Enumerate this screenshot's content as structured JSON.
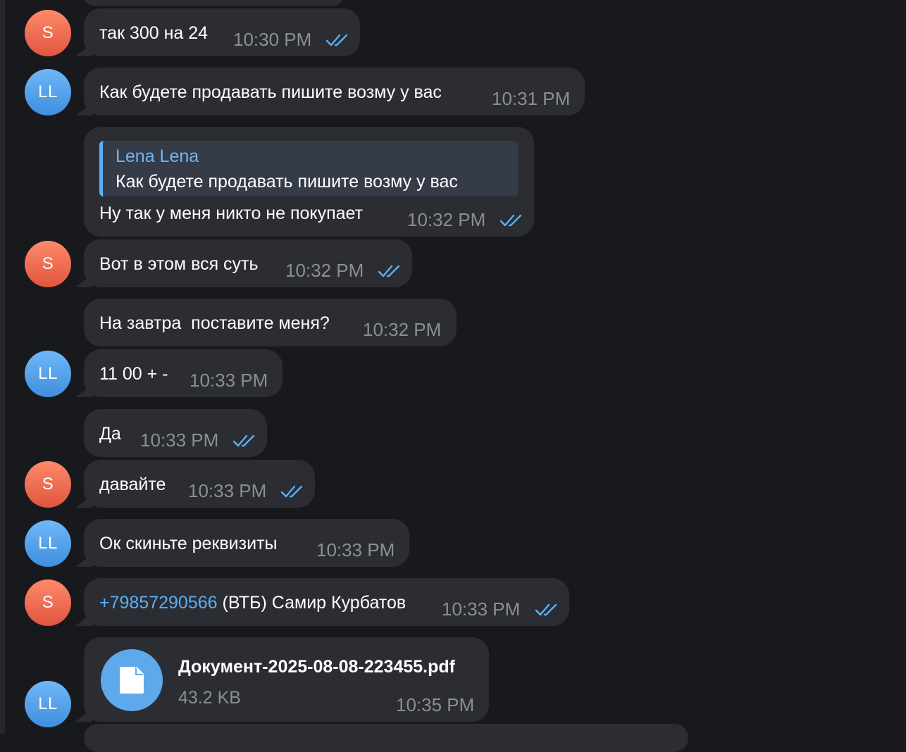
{
  "avatars": {
    "s": "S",
    "ll": "LL"
  },
  "messages": [
    {
      "text": "так 300 на 24",
      "time": "10:30 PM",
      "read": true
    },
    {
      "text": "Как будете продавать пишите возму у вас",
      "time": "10:31 PM"
    },
    {
      "reply_name": "Lena Lena",
      "reply_text": "Как будете продавать пишите возму у вас",
      "text": "Ну так у меня никто не покупает",
      "time": "10:32 PM",
      "read": true
    },
    {
      "text": "Вот в этом вся суть",
      "time": "10:32 PM",
      "read": true
    },
    {
      "text": "На завтра  поставите меня?",
      "time": "10:32 PM"
    },
    {
      "text": "11 00 + -",
      "time": "10:33 PM"
    },
    {
      "text": "Да",
      "time": "10:33 PM",
      "read": true
    },
    {
      "text": "давайте",
      "time": "10:33 PM",
      "read": true
    },
    {
      "text": "Ок скиньте реквизиты",
      "time": "10:33 PM"
    },
    {
      "phone": "+79857290566",
      "text": " (ВТБ) Самир Курбатов",
      "time": "10:33 PM",
      "read": true
    },
    {
      "file_name": "Документ-2025-08-08-223455.pdf",
      "file_size": "43.2 KB",
      "time": "10:35 PM"
    }
  ],
  "colors": {
    "background": "#18191d",
    "bubble": "#2b2d33",
    "accent": "#5ab0f5",
    "time": "#8b8e95",
    "avatar_s": "#e0553f",
    "avatar_ll": "#3f8fdf"
  },
  "icons": {
    "read": "double-check-icon",
    "file": "document-icon"
  }
}
